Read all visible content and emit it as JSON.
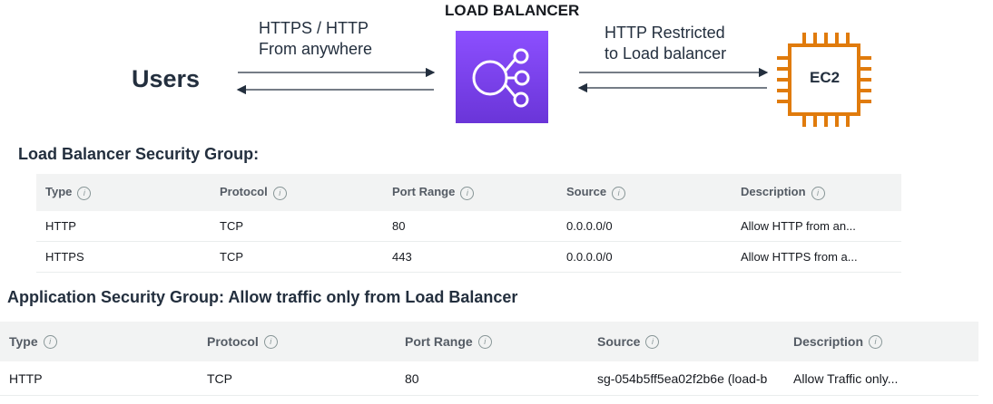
{
  "diagram": {
    "load_balancer_title": "LOAD BALANCER",
    "users_label": "Users",
    "left_label_line1": "HTTPS / HTTP",
    "left_label_line2": "From anywhere",
    "right_label_line1": "HTTP Restricted",
    "right_label_line2": "to Load balancer",
    "ec2_label": "EC2",
    "lb_color": "#7b45f0",
    "ec2_color": "#e07b0c"
  },
  "lb_sg": {
    "title": "Load Balancer Security Group:",
    "info_glyph": "i",
    "headers": [
      "Type",
      "Protocol",
      "Port Range",
      "Source",
      "Description"
    ],
    "rows": [
      [
        "HTTP",
        "TCP",
        "80",
        "0.0.0.0/0",
        "Allow HTTP from an..."
      ],
      [
        "HTTPS",
        "TCP",
        "443",
        "0.0.0.0/0",
        "Allow HTTPS from a..."
      ]
    ]
  },
  "app_sg": {
    "title": "Application Security Group: Allow traffic only from Load Balancer",
    "headers": [
      "Type",
      "Protocol",
      "Port Range",
      "Source",
      "Description"
    ],
    "rows": [
      [
        "HTTP",
        "TCP",
        "80",
        "sg-054b5ff5ea02f2b6e (load-b",
        "Allow Traffic only..."
      ]
    ]
  }
}
